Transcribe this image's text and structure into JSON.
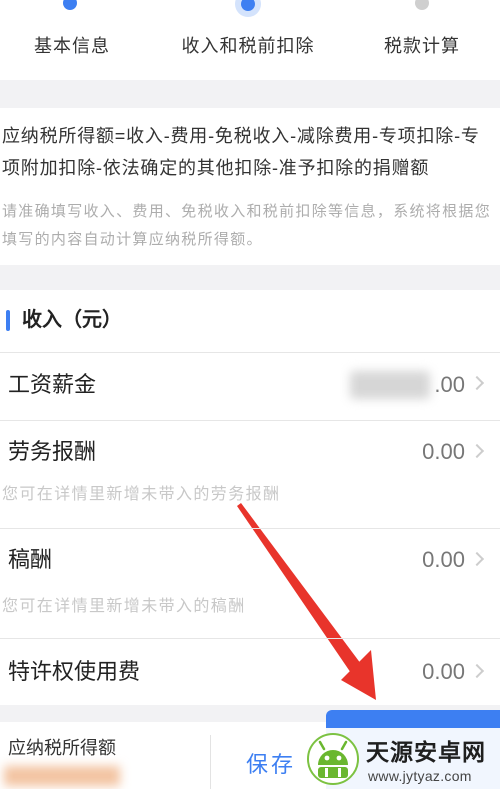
{
  "steps": {
    "current": 2,
    "items": [
      {
        "label": "基本信息"
      },
      {
        "label": "收入和税前扣除"
      },
      {
        "label": "税款计算"
      }
    ]
  },
  "formula": {
    "text": "应纳税所得额=收入-费用-免税收入-减除费用-专项扣除-专项附加扣除-依法确定的其他扣除-准予扣除的捐赠额",
    "hint": "请准确填写收入、费用、免税收入和税前扣除等信息，系统将根据您填写的内容自动计算应纳税所得额。"
  },
  "income": {
    "title": "收入（元）",
    "rows": [
      {
        "label": "工资薪金",
        "value": ".00"
      },
      {
        "label": "劳务报酬",
        "value": "0.00",
        "hint": "您可在详情里新增未带入的劳务报酬"
      },
      {
        "label": "稿酬",
        "value": "0.00",
        "hint": "您可在详情里新增未带入的稿酬"
      },
      {
        "label": "特许权使用费",
        "value": "0.00"
      }
    ]
  },
  "bottom_bar": {
    "taxable_income_label": "应纳税所得额",
    "save_label": "保存"
  },
  "watermark": {
    "name": "天源安卓网",
    "url": "www.jytyaz.com"
  },
  "icons": {
    "step_dot": "step-dot-icon",
    "row_chevron": "chevron-right-icon",
    "watermark_logo": "android-logo-icon",
    "annotation": "red-arrow-icon"
  },
  "colors": {
    "accent": "#3d7ff2",
    "annotation_arrow": "#e8342b"
  }
}
